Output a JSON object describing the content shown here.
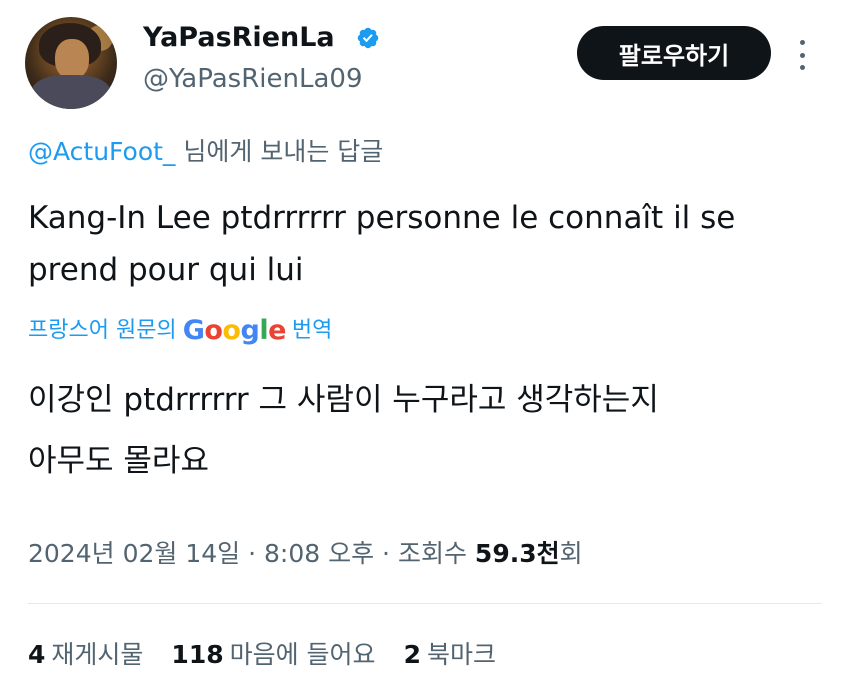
{
  "user": {
    "display_name": "YaPasRienLa",
    "handle": "@YaPasRienLa09",
    "verified_color": "#1d9bf0"
  },
  "header": {
    "follow_label": "팔로우하기",
    "more_icon": "more-vertical-icon"
  },
  "reply": {
    "mention": "@ActuFoot_",
    "suffix": " 님에게 보내는 답글"
  },
  "tweet": {
    "text": "Kang-In Lee ptdrrrrrr personne le connaît il se prend pour qui lui",
    "translate_prefix": "프랑스어 원문의",
    "translate_brand": "Google",
    "translate_suffix": "번역",
    "translated_line1": "이강인 ptdrrrrrr 그 사람이 누구라고 생각하는지",
    "translated_line2": "아무도 몰라요"
  },
  "meta": {
    "date": "2024년 02월 14일",
    "time": "8:08 오후",
    "views_label": "조회수",
    "views_value": "59.3천",
    "views_suffix": "회",
    "separator": "·"
  },
  "stats": {
    "reposts_count": "4",
    "reposts_label": "재게시물",
    "likes_count": "118",
    "likes_label": "마음에 들어요",
    "bookmarks_count": "2",
    "bookmarks_label": "북마크"
  },
  "colors": {
    "accent": "#1d9bf0",
    "text": "#0f1419",
    "muted": "#536471",
    "google_blue": "#4285F4",
    "google_red": "#EA4335",
    "google_yellow": "#FBBC05",
    "google_green": "#34A853"
  }
}
